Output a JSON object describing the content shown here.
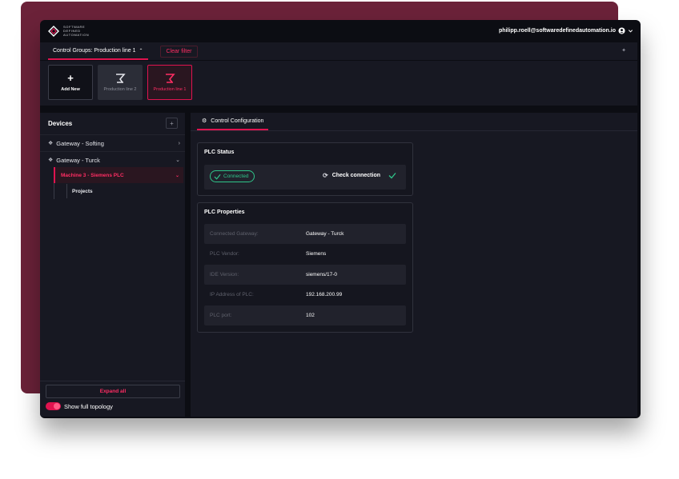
{
  "brand": {
    "logo_text_line1": "SOFTWARE",
    "logo_text_line2": "DEFINED",
    "logo_text_line3": "AUTOMATION"
  },
  "header": {
    "user_email": "philipp.roell@softwaredefinedautomation.io"
  },
  "groups_bar": {
    "group_select_label": "Control Groups: Production line 1",
    "clear_filter_label": "Clear filter"
  },
  "tiles": {
    "add_new_label": "Add New",
    "items": [
      {
        "label": "Production line 2",
        "selected": false
      },
      {
        "label": "Production line 1",
        "selected": true
      }
    ]
  },
  "sidebar": {
    "title": "Devices",
    "add_symbol": "+",
    "tree": [
      {
        "label": "Gateway - Softing",
        "expanded": false
      },
      {
        "label": "Gateway - Turck",
        "expanded": true
      }
    ],
    "machine_label": "Machine 3 - Siemens PLC",
    "projects_label": "Projects",
    "expand_all_label": "Expand all",
    "show_topology_label": "Show full topology",
    "show_topology_on": true
  },
  "main": {
    "tab_label": "Control Configuration",
    "plc_status": {
      "title": "PLC Status",
      "status_label": "Connected",
      "check_label": "Check connection"
    },
    "plc_properties": {
      "title": "PLC Properties",
      "rows": [
        {
          "label": "Connected Gateway:",
          "value": "Gateway - Turck"
        },
        {
          "label": "PLC Vendor:",
          "value": "Siemens"
        },
        {
          "label": "IDE Version:",
          "value": "siemens/17-0"
        },
        {
          "label": "IP Address of PLC:",
          "value": "192.168.200.99"
        },
        {
          "label": "PLC port:",
          "value": "102"
        }
      ]
    }
  },
  "colors": {
    "accent": "#e0134f",
    "accent_text": "#ff2d63",
    "success": "#2fc58a",
    "backdrop": "#6b2239"
  }
}
